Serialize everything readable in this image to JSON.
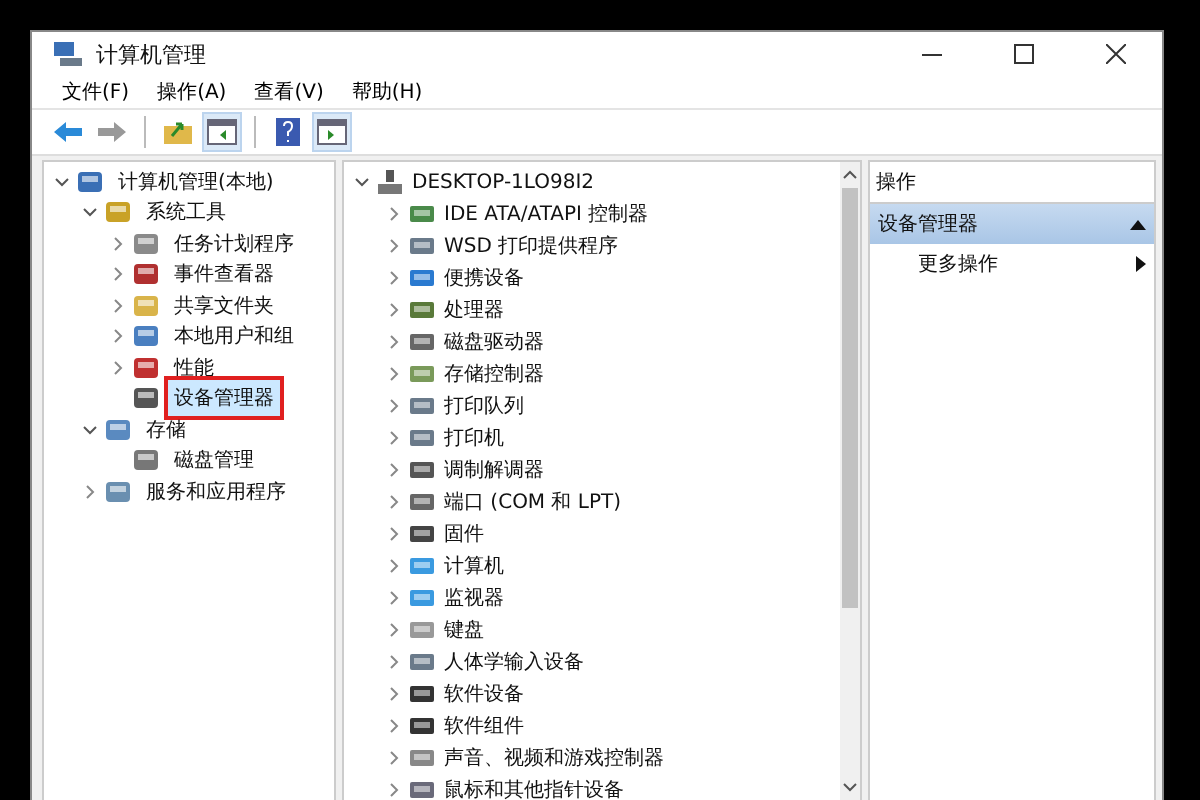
{
  "window": {
    "title": "计算机管理"
  },
  "menu": [
    "文件(F)",
    "操作(A)",
    "查看(V)",
    "帮助(H)"
  ],
  "toolbar": [
    {
      "kind": "back",
      "disabled": false
    },
    {
      "kind": "forward",
      "disabled": true
    },
    {
      "kind": "sep"
    },
    {
      "kind": "up"
    },
    {
      "kind": "pane"
    },
    {
      "kind": "sep"
    },
    {
      "kind": "help"
    },
    {
      "kind": "pane2"
    }
  ],
  "tree": [
    {
      "label": "计算机管理(本地)",
      "expanded": true,
      "selected": false,
      "children": [
        {
          "label": "系统工具",
          "expanded": true,
          "selected": false,
          "children": [
            {
              "label": "任务计划程序",
              "expanded": false,
              "selected": false
            },
            {
              "label": "事件查看器",
              "expanded": false,
              "selected": false
            },
            {
              "label": "共享文件夹",
              "expanded": false,
              "selected": false
            },
            {
              "label": "本地用户和组",
              "expanded": false,
              "selected": false
            },
            {
              "label": "性能",
              "expanded": false,
              "selected": false
            },
            {
              "label": "设备管理器",
              "selected": true
            }
          ]
        },
        {
          "label": "存储",
          "expanded": true,
          "selected": false,
          "children": [
            {
              "label": "磁盘管理",
              "selected": false
            }
          ]
        },
        {
          "label": "服务和应用程序",
          "expanded": false,
          "selected": false
        }
      ]
    }
  ],
  "devices": {
    "computer": "DESKTOP-1LO98I2",
    "categories": [
      "IDE ATA/ATAPI 控制器",
      "WSD 打印提供程序",
      "便携设备",
      "处理器",
      "磁盘驱动器",
      "存储控制器",
      "打印队列",
      "打印机",
      "调制解调器",
      "端口 (COM 和 LPT)",
      "固件",
      "计算机",
      "监视器",
      "键盘",
      "人体学输入设备",
      "软件设备",
      "软件组件",
      "声音、视频和游戏控制器",
      "鼠标和其他指针设备"
    ]
  },
  "actions": {
    "header": "操作",
    "section": "设备管理器",
    "items": [
      "更多操作"
    ]
  }
}
